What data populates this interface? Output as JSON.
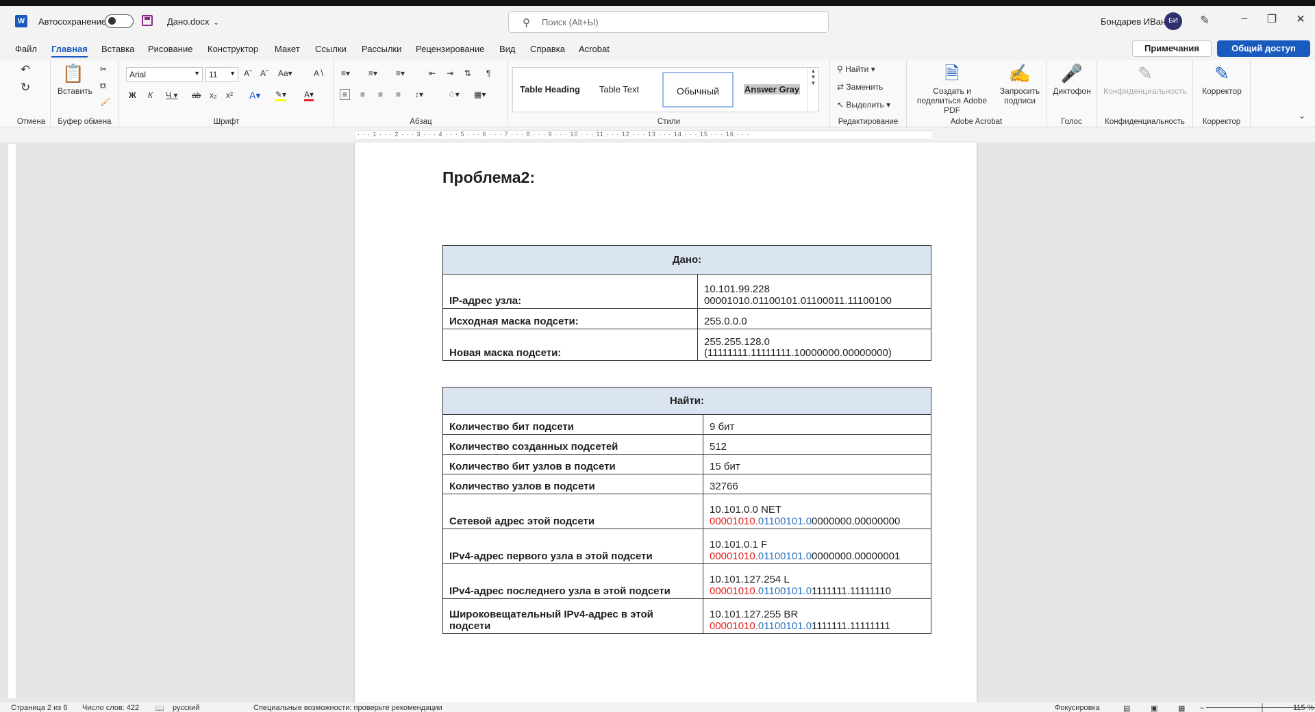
{
  "titlebar": {
    "autosave_label": "Автосохранение",
    "doc_name": "Дано.docx",
    "search_placeholder": "Поиск (Alt+Ы)",
    "user_name": "Бондарев ИВан",
    "avatar_initials": "БИ"
  },
  "menu": {
    "tabs": [
      "Файл",
      "Главная",
      "Вставка",
      "Рисование",
      "Конструктор",
      "Макет",
      "Ссылки",
      "Рассылки",
      "Рецензирование",
      "Вид",
      "Справка",
      "Acrobat"
    ],
    "comments": "Примечания",
    "share": "Общий доступ"
  },
  "ribbon": {
    "groups": {
      "undo": "Отмена",
      "clipboard": "Буфер обмена",
      "font": "Шрифт",
      "paragraph": "Абзац",
      "styles": "Стили",
      "editing": "Редактирование",
      "acrobat": "Adobe Acrobat",
      "voice": "Голос",
      "privacy": "Конфиденциальность",
      "corrector": "Корректор"
    },
    "paste_label": "Вставить",
    "font_name": "Arial",
    "font_size": "11",
    "styles": [
      "Table Heading",
      "Table Text",
      "Обычный",
      "Answer Gray"
    ],
    "find": "Найти",
    "replace": "Заменить",
    "select": "Выделить",
    "create_pdf": "Создать и поделиться Adobe PDF",
    "request_sign": "Запросить подписи",
    "dictate": "Диктофон",
    "privacy_btn": "Конфиденциальность",
    "corrector_btn": "Корректор"
  },
  "document": {
    "heading": "Проблема2:",
    "given": {
      "header": "Дано:",
      "rows": [
        {
          "label": "IP-адрес узла:",
          "line1": "10.101.99.228",
          "line2": "00001010.01100101.01100011.11100100"
        },
        {
          "label": "Исходная маска подсети:",
          "line1": "255.0.0.0",
          "line2": ""
        },
        {
          "label": "Новая маска подсети:",
          "line1": "255.255.128.0",
          "line2": "(11111111.11111111.10000000.00000000)"
        }
      ]
    },
    "find": {
      "header": "Найти:",
      "rows": [
        {
          "label": "Количество бит подсети",
          "value": "9 бит"
        },
        {
          "label": "Количество созданных подсетей",
          "value": "512"
        },
        {
          "label": "Количество бит узлов в подсети",
          "value": "15 бит"
        },
        {
          "label": "Количество узлов в подсети",
          "value": "32766"
        }
      ],
      "addr_rows": [
        {
          "label": "Сетевой адрес этой подсети",
          "line1": "10.101.0.0 NET",
          "red": "00001010.",
          "blue": "01100101.0",
          "rest": "0000000.00000000"
        },
        {
          "label": "IPv4-адрес первого узла в этой подсети",
          "line1": "10.101.0.1 F",
          "red": "00001010.",
          "blue": "01100101.0",
          "rest": "0000000.00000001"
        },
        {
          "label": "IPv4-адрес последнего узла в этой подсети",
          "line1": "10.101.127.254 L",
          "red": "00001010.",
          "blue": "01100101.0",
          "rest": "1111111.11111110"
        },
        {
          "label": "Широковещательный IPv4-адрес в этой подсети",
          "line1": "10.101.127.255 BR",
          "red": "00001010.",
          "blue": "01100101.0",
          "rest": "1111111.11111111"
        }
      ]
    }
  },
  "statusbar": {
    "page": "Страница 2 из 6",
    "words": "Число слов: 422",
    "language": "русский",
    "accessibility": "Специальные возможности: проверьте рекомендации",
    "focus": "Фокусировка",
    "zoom": "115 %"
  }
}
